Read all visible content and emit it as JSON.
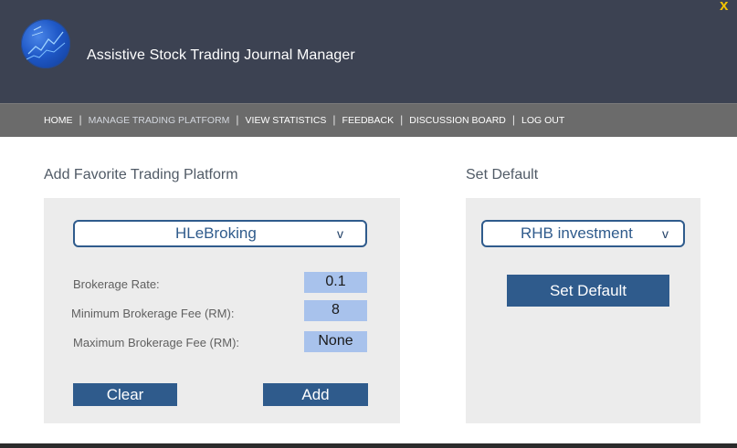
{
  "header": {
    "title": "Assistive Stock Trading Journal Manager",
    "close_glyph": "x"
  },
  "nav": {
    "items": [
      {
        "label": "HOME"
      },
      {
        "label": "MANAGE TRADING PLATFORM"
      },
      {
        "label": "VIEW STATISTICS"
      },
      {
        "label": "FEEDBACK"
      },
      {
        "label": "DISCUSSION BOARD"
      },
      {
        "label": "LOG OUT"
      }
    ],
    "active": "MANAGE TRADING PLATFORM",
    "separator": "|"
  },
  "add_panel": {
    "title": "Add Favorite Trading Platform",
    "platform_select": {
      "value": "HLeBroking",
      "arrow": "v"
    },
    "fields": [
      {
        "label": "Brokerage Rate:",
        "value": "0.1"
      },
      {
        "label": "Minimum Brokerage Fee (RM):",
        "value": "8"
      },
      {
        "label": "Maximum Brokerage Fee (RM):",
        "value": "None"
      }
    ],
    "clear_label": "Clear",
    "add_label": "Add"
  },
  "default_panel": {
    "title": "Set Default",
    "platform_select": {
      "value": "RHB investment",
      "arrow": "v"
    },
    "set_default_label": "Set Default"
  },
  "colors": {
    "header_bg": "#3c4252",
    "nav_bg": "#6b6b6b",
    "accent": "#2f5b8c",
    "value_bg": "#a8c2ec",
    "panel_bg": "#ececec",
    "close_color": "#f0c200"
  }
}
